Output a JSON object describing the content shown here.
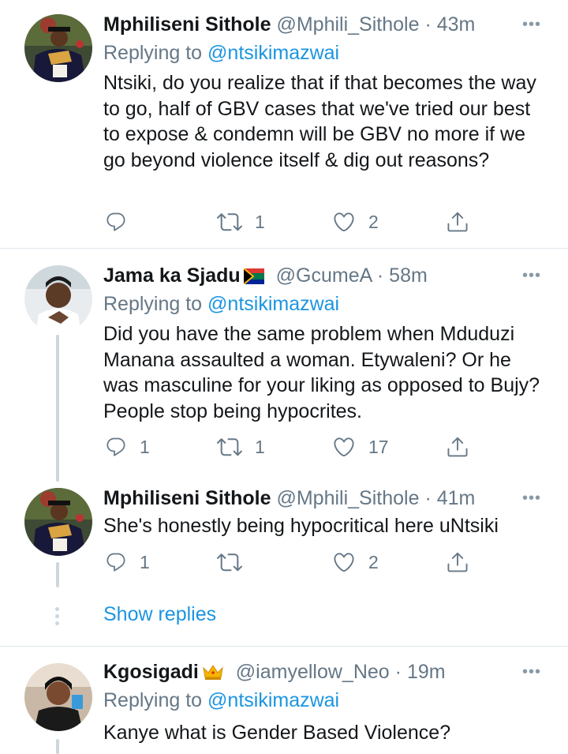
{
  "tweets": [
    {
      "name": "Mphiliseni Sithole",
      "handle": "@Mphili_Sithole",
      "separator": "·",
      "time": "43m",
      "reply_prefix": "Replying to",
      "reply_to": "@ntsikimazwai",
      "text": "Ntsiki, do you realize that if that becomes the way to go, half of GBV cases that we've tried our best to expose & condemn will be GBV no more if we go beyond violence itself & dig out reasons?",
      "replies": "",
      "retweets": "1",
      "likes": "2"
    },
    {
      "name": "Jama ka Sjadu",
      "name_emoji": "south-africa-flag-icon",
      "handle": "@GcumeA",
      "separator": "·",
      "time": "58m",
      "reply_prefix": "Replying to",
      "reply_to": "@ntsikimazwai",
      "text": "Did you have the same problem when Mduduzi Manana assaulted a woman. Etywaleni? Or he was masculine for your liking as opposed to Bujy? People stop being hypocrites.",
      "replies": "1",
      "retweets": "1",
      "likes": "17"
    },
    {
      "name": "Mphiliseni Sithole",
      "handle": "@Mphili_Sithole",
      "separator": "·",
      "time": "41m",
      "text": "She's honestly being hypocritical here uNtsiki",
      "replies": "1",
      "retweets": "",
      "likes": "2"
    },
    {
      "name": "Kgosigadi",
      "name_emoji": "crown-icon",
      "handle": "@iamyellow_Neo",
      "separator": "·",
      "time": "19m",
      "reply_prefix": "Replying to",
      "reply_to": "@ntsikimazwai",
      "text": "Kanye what is Gender Based Violence?"
    }
  ],
  "show_replies": "Show replies",
  "more_label": "•••",
  "colors": {
    "link": "#1b95e0",
    "secondary_text": "#657786",
    "divider": "#e1e8ed",
    "thread_line": "#ccd6dd"
  }
}
